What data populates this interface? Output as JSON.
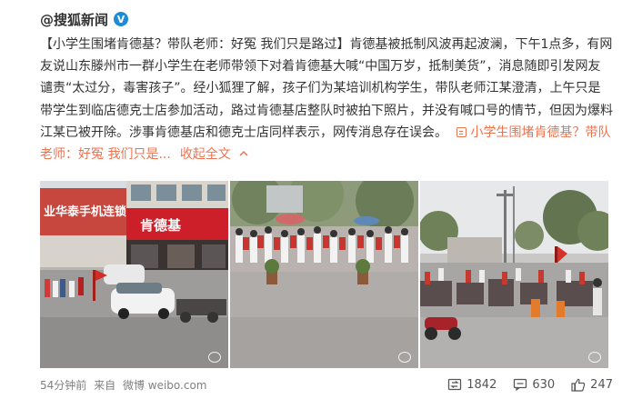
{
  "post": {
    "author": "@搜狐新闻",
    "verified_badge": "V",
    "title_bracketed": "【小学生围堵肯德基？带队老师：好冤 我们只是路过】",
    "body": "肯德基被抵制风波再起波澜，下午1点多，有网友说山东滕州市一群小学生在老师带领下对着肯德基大喊“中国万岁，抵制美货”，消息随即引发网友谴责“太过分，毒害孩子”。经小狐狸了解，孩子们为某培训机构学生，带队老师江某澄清，上午只是带学生到临店德克士店参加活动，路过肯德基店整队时被拍下照片，并没有喊口号的情节，但因为爆料江某已被开除。涉事肯德基店和德克士店同样表示，网传消息存在误会。",
    "link_text": "小学生围堵肯德基？带队老师：好冤 我们只是...",
    "collapse_text": "收起全文",
    "collapse_icon": "chevron-up-icon"
  },
  "photos": [
    {
      "name": "photo-kfc-storefront",
      "description_icon": "photo"
    },
    {
      "name": "photo-students-crowd",
      "description_icon": "photo"
    },
    {
      "name": "photo-street-parked-bikes",
      "description_icon": "photo"
    }
  ],
  "footer": {
    "time": "54分钟前",
    "from_label": "来自",
    "source": "微博 weibo.com",
    "repost_count": "1842",
    "comment_count": "630",
    "like_count": "247"
  },
  "colors": {
    "accent": "#eb7350",
    "verified": "#1f8bd6",
    "meta": "#808080"
  }
}
